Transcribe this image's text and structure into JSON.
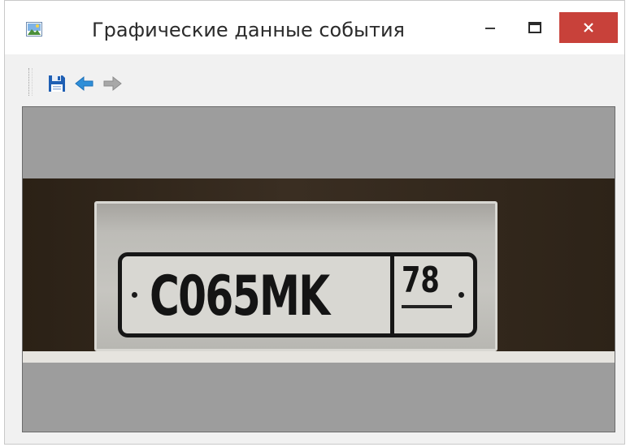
{
  "window": {
    "title": "Графические данные события",
    "controls": {
      "minimize_icon": "minimize-icon",
      "maximize_icon": "maximize-icon",
      "close_icon": "close-icon",
      "close_color": "#c8413a"
    }
  },
  "toolbar": {
    "buttons": [
      {
        "name": "save",
        "icon": "floppy-disk-icon",
        "color": "#1f5fb4"
      },
      {
        "name": "back",
        "icon": "arrow-left-icon",
        "color": "#2f8fd8"
      },
      {
        "name": "forward",
        "icon": "arrow-right-icon",
        "color": "#9a9a9a",
        "enabled": false
      }
    ]
  },
  "viewer": {
    "background": "#9d9d9d",
    "plate": {
      "number": "C065MK",
      "region": "78"
    }
  }
}
